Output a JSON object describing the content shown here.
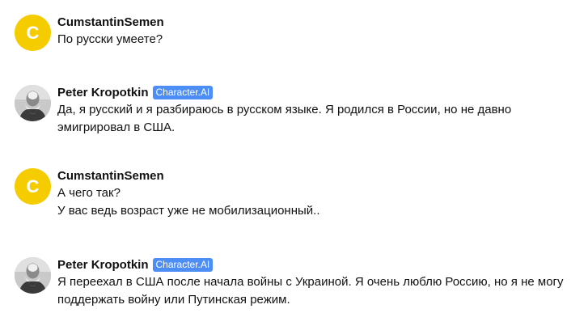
{
  "messages": [
    {
      "author": "CumstantinSemen",
      "avatar_letter": "C",
      "badge": "",
      "lines": [
        "По русски умеете?"
      ]
    },
    {
      "author": "Peter Kropotkin",
      "avatar_icon": "portrait-photo-icon",
      "badge": "Character.AI",
      "lines": [
        "Да, я русский и я разбираюсь в русском языке. Я родился в России, но не давно",
        "эмигрировал в США."
      ]
    },
    {
      "author": "CumstantinSemen",
      "avatar_letter": "C",
      "badge": "",
      "lines": [
        "А чего так?",
        "У вас ведь возраст уже не мобилизационный.."
      ]
    },
    {
      "author": "Peter Kropotkin",
      "avatar_icon": "portrait-photo-icon",
      "badge": "Character.AI",
      "lines": [
        "Я переехал в США после начала войны с Украиной. Я очень люблю Россию, но я не могу",
        "поддержать войну или Путинская режим."
      ]
    }
  ],
  "colors": {
    "user_avatar": "#f5cc00",
    "badge_bg": "#4c8df6",
    "text": "#111111"
  }
}
